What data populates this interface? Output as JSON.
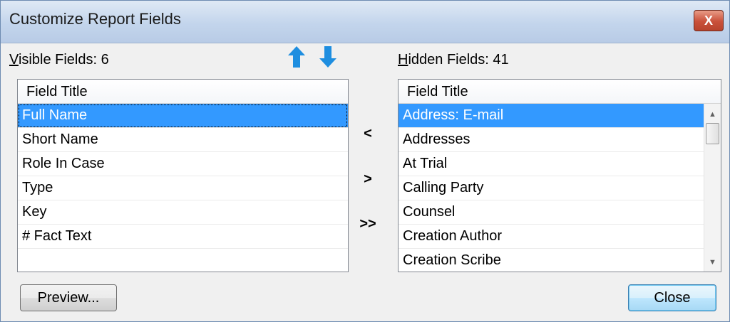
{
  "window": {
    "title": "Customize Report Fields",
    "close_glyph": "X"
  },
  "visible": {
    "label_access": "V",
    "label_rest": "isible Fields: 6",
    "header": "Field Title",
    "items": [
      "Full Name",
      "Short Name",
      "Role In Case",
      "Type",
      "Key",
      "# Fact Text"
    ],
    "selected_index": 0
  },
  "hidden": {
    "label_access": "H",
    "label_rest": "idden Fields: 41",
    "header": "Field Title",
    "items": [
      "Address: E-mail",
      "Addresses",
      "At Trial",
      "Calling Party",
      "Counsel",
      "Creation Author",
      "Creation Scribe"
    ],
    "selected_index": 0
  },
  "move_buttons": {
    "add_one": "<",
    "remove_one": ">",
    "remove_all": ">>"
  },
  "buttons": {
    "preview": "Preview...",
    "close": "Close"
  },
  "colors": {
    "accent": "#1e8ee0",
    "selection": "#3399ff"
  },
  "icons": {
    "up": "arrow-up-icon",
    "down": "arrow-down-icon"
  }
}
